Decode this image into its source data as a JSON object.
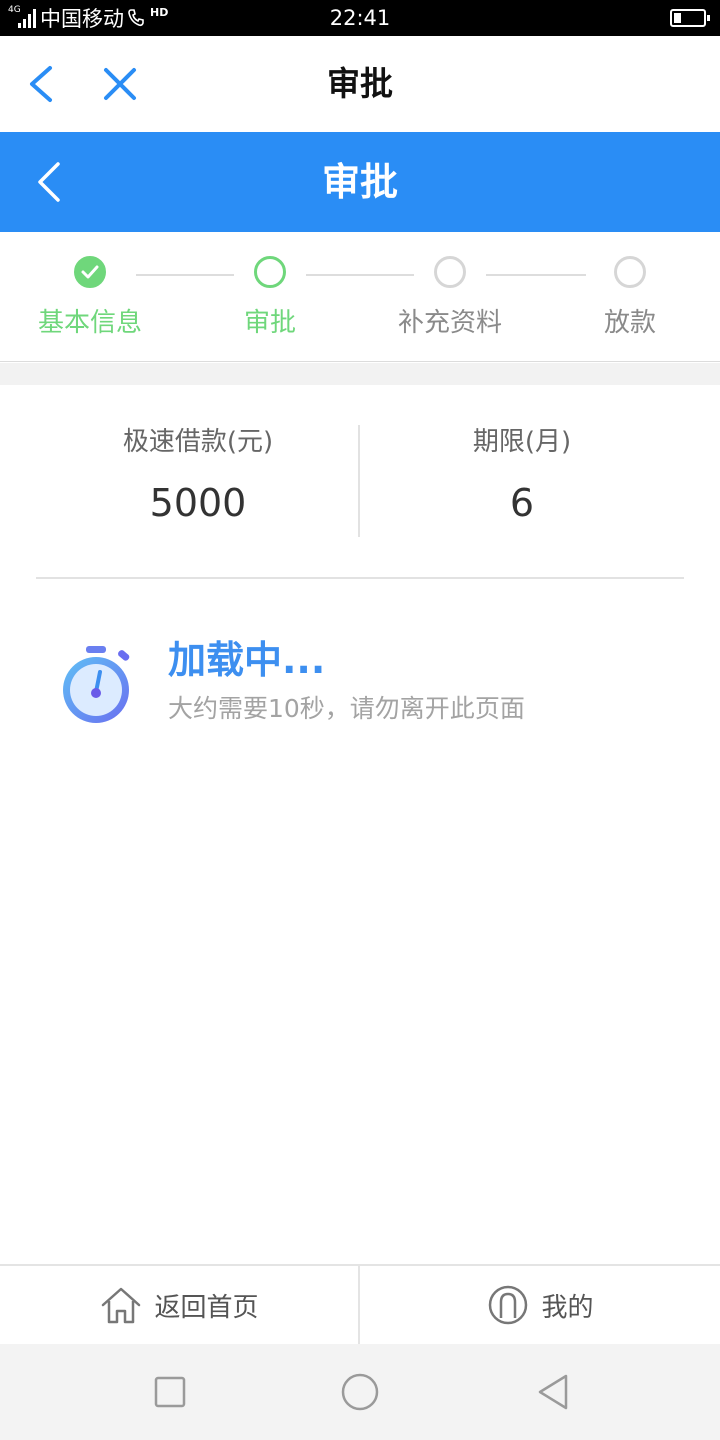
{
  "status_bar": {
    "network_tag": "4G",
    "carrier": "中国移动",
    "hd": "HD",
    "time": "22:41",
    "battery_level": 0.25
  },
  "nav": {
    "title": "审批",
    "back_icon": "chevron-left-icon",
    "close_icon": "close-icon"
  },
  "header": {
    "title": "审批",
    "color": "#2a8df5"
  },
  "steps": {
    "active_color": "#6fd77b",
    "items": [
      {
        "label": "基本信息",
        "state": "done"
      },
      {
        "label": "审批",
        "state": "active"
      },
      {
        "label": "补充资料",
        "state": "pending"
      },
      {
        "label": "放款",
        "state": "pending"
      }
    ]
  },
  "loan": {
    "amount_label": "极速借款(元)",
    "amount_value": "5000",
    "term_label": "期限(月)",
    "term_value": "6"
  },
  "loading": {
    "title": "加载中...",
    "subtitle": "大约需要10秒，请勿离开此页面",
    "icon": "stopwatch-icon"
  },
  "tabbar": {
    "home_label": "返回首页",
    "home_icon": "home-icon",
    "mine_label": "我的",
    "mine_icon": "user-icon"
  },
  "system_nav": {
    "recent": "square-icon",
    "home": "circle-icon",
    "back": "triangle-back-icon"
  }
}
